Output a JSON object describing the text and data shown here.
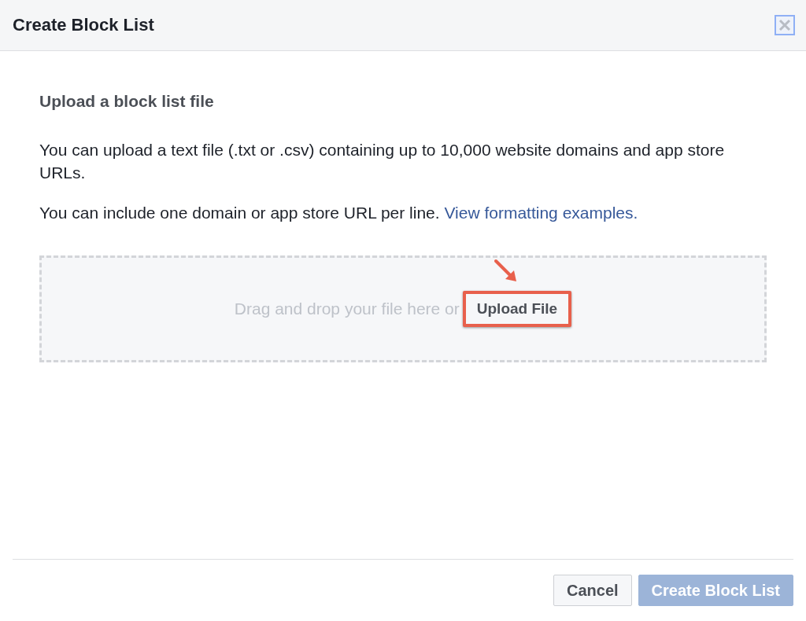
{
  "dialog": {
    "title": "Create Block List"
  },
  "section": {
    "heading": "Upload a block list file",
    "paragraphs": [
      {
        "text": "You can upload a text file (.txt or .csv) containing up to 10,000 website domains and app store URLs."
      },
      {
        "text": "You can include one domain or app store URL per line.",
        "link": "View formatting examples."
      }
    ]
  },
  "dropzone": {
    "hint": "Drag and drop your file here or",
    "button": "Upload File",
    "highlighted": true
  },
  "buttons": [
    {
      "label": "Cancel",
      "kind": "secondary",
      "disabled": false
    },
    {
      "label": "Create Block List",
      "kind": "primary",
      "disabled": true
    }
  ]
}
